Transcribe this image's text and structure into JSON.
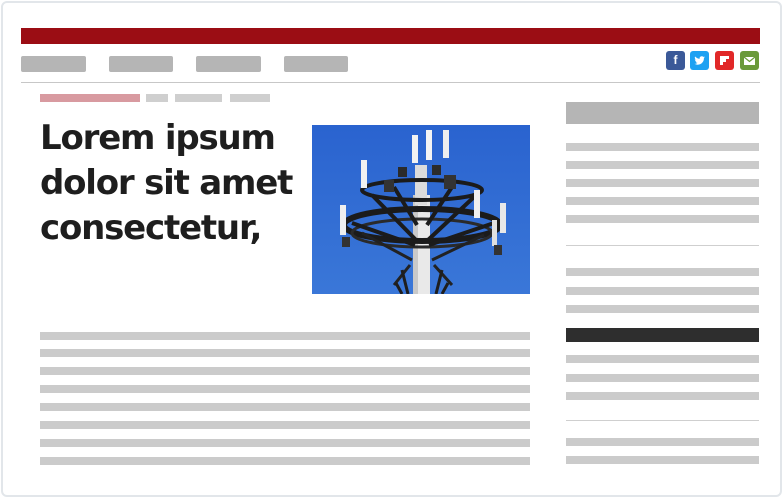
{
  "article": {
    "headline": "Lorem ipsum dolor sit amet consectetur,"
  },
  "colors": {
    "brand_bar": "#9b0d14",
    "placeholder": "#b5b5b5",
    "text_line": "#cbcbcb",
    "dark_block": "#2e2e2e",
    "facebook": "#3b5998",
    "twitter": "#1da1f2",
    "flipboard": "#e12828",
    "email": "#6a9a3a"
  },
  "social": {
    "facebook_glyph": "f",
    "twitter_glyph": "t",
    "flipboard_glyph": "f",
    "email_glyph": "✉"
  },
  "icons": [
    "facebook-icon",
    "twitter-icon",
    "flipboard-icon",
    "email-icon"
  ]
}
